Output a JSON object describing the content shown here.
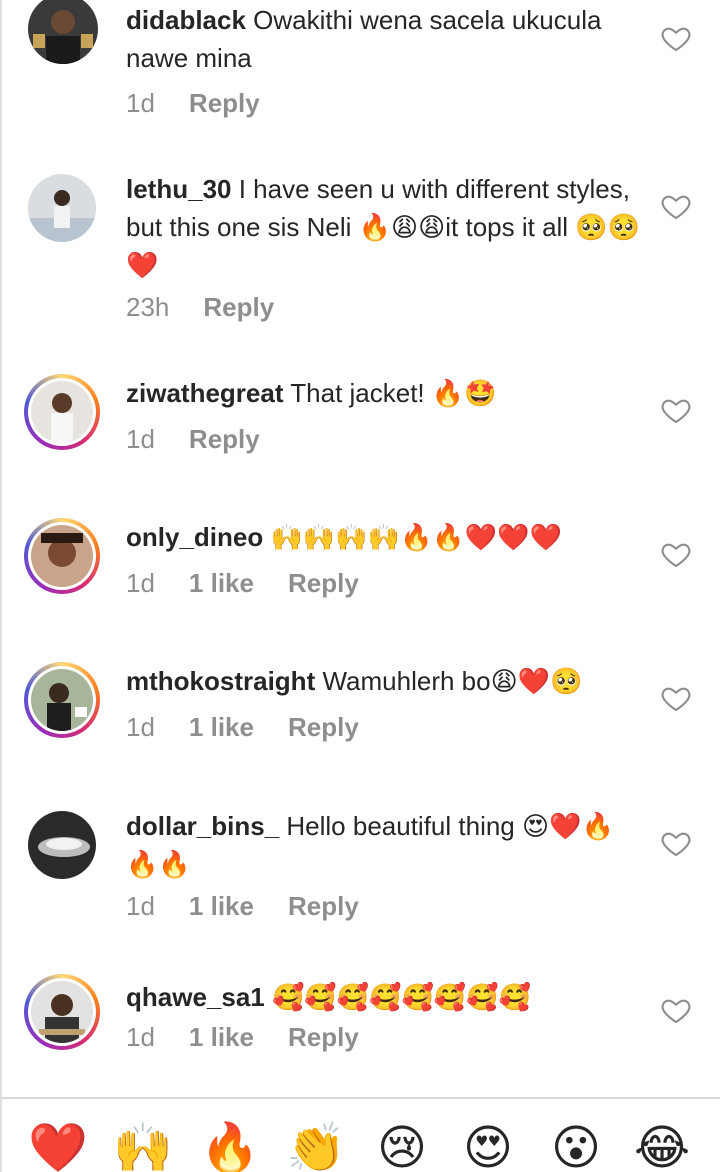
{
  "comments": [
    {
      "username": "didablack",
      "text": "Owakithi wena sacela ukucula nawe mina",
      "time": "1d",
      "likes": "",
      "reply": "Reply"
    },
    {
      "username": "lethu_30",
      "text": "I have seen u with different styles, but this one sis Neli 🔥😩😩it tops it all 🥺🥺❤️",
      "time": "23h",
      "likes": "",
      "reply": "Reply"
    },
    {
      "username": "ziwathegreat",
      "text": "That jacket! 🔥🤩",
      "time": "1d",
      "likes": "",
      "reply": "Reply"
    },
    {
      "username": "only_dineo",
      "text": "🙌🙌🙌🙌🔥🔥❤️❤️❤️",
      "time": "1d",
      "likes": "1 like",
      "reply": "Reply"
    },
    {
      "username": "mthokostraight",
      "text": "Wamuhlerh bo😩❤️🥺",
      "time": "1d",
      "likes": "1 like",
      "reply": "Reply"
    },
    {
      "username": "dollar_bins_",
      "text": "Hello beautiful thing 😍❤️🔥🔥🔥",
      "time": "1d",
      "likes": "1 like",
      "reply": "Reply"
    },
    {
      "username": "qhawe_sa1",
      "text": "🥰🥰🥰🥰🥰🥰🥰🥰",
      "time": "1d",
      "likes": "1 like",
      "reply": "Reply"
    }
  ],
  "reactions": [
    "❤️",
    "🙌",
    "🔥",
    "👏",
    "😢",
    "😍",
    "😮",
    "😂"
  ],
  "colors": {
    "text": "#262626",
    "meta": "#8e8e8e",
    "heart_outline": "#8e8e8e",
    "story_ring_start": "#feda75",
    "story_ring_end": "#962fbf"
  }
}
